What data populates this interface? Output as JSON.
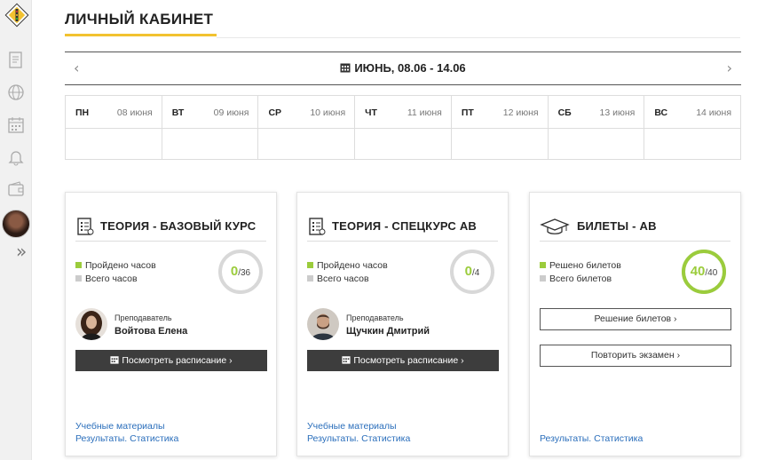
{
  "sidebar": {
    "logo": "road-sign-logo",
    "icons": [
      "document-icon",
      "globe-icon",
      "calendar-icon",
      "bell-icon",
      "wallet-icon"
    ],
    "expand": "»"
  },
  "header": {
    "title": "ЛИЧНЫЙ КАБИНЕТ"
  },
  "week": {
    "label": "ИЮНЬ, 08.06 - 14.06",
    "prev": "‹",
    "next": "›"
  },
  "calendar": {
    "days": [
      {
        "dow": "ПН",
        "date": "08 июня"
      },
      {
        "dow": "ВТ",
        "date": "09 июня"
      },
      {
        "dow": "СР",
        "date": "10 июня"
      },
      {
        "dow": "ЧТ",
        "date": "11 июня"
      },
      {
        "dow": "ПТ",
        "date": "12 июня"
      },
      {
        "dow": "СБ",
        "date": "13 июня"
      },
      {
        "dow": "ВС",
        "date": "14 июня"
      }
    ]
  },
  "cards": [
    {
      "title": "ТЕОРИЯ - БАЗОВЫЙ КУРС",
      "icon": "document-list-icon",
      "legend_done": "Пройдено часов",
      "legend_total": "Всего часов",
      "done": "0",
      "total": "/36",
      "progress_fraction": 0,
      "teacher_role": "Преподаватель",
      "teacher_name": "Войтова Елена",
      "schedule_button": "Посмотреть расписание",
      "link_materials": "Учебные материалы",
      "link_results": "Результаты. Статистика"
    },
    {
      "title": "ТЕОРИЯ - СПЕЦКУРС АВ",
      "icon": "document-list-icon",
      "legend_done": "Пройдено часов",
      "legend_total": "Всего часов",
      "done": "0",
      "total": "/4",
      "progress_fraction": 0,
      "teacher_role": "Преподаватель",
      "teacher_name": "Щучкин Дмитрий",
      "schedule_button": "Посмотреть расписание",
      "link_materials": "Учебные материалы",
      "link_results": "Результаты. Статистика"
    },
    {
      "title": "БИЛЕТЫ - АВ",
      "icon": "graduation-cap-icon",
      "legend_done": "Решено билетов",
      "legend_total": "Всего билетов",
      "done": "40",
      "total": "/40",
      "progress_fraction": 1,
      "button_solve": "Решение билетов",
      "button_repeat": "Повторить экзамен",
      "link_results": "Результаты. Статистика"
    }
  ],
  "colors": {
    "accent": "#f2c230",
    "progress": "#9bcc3c",
    "link": "#2a6ebb",
    "dark_button": "#3d3d3d"
  }
}
